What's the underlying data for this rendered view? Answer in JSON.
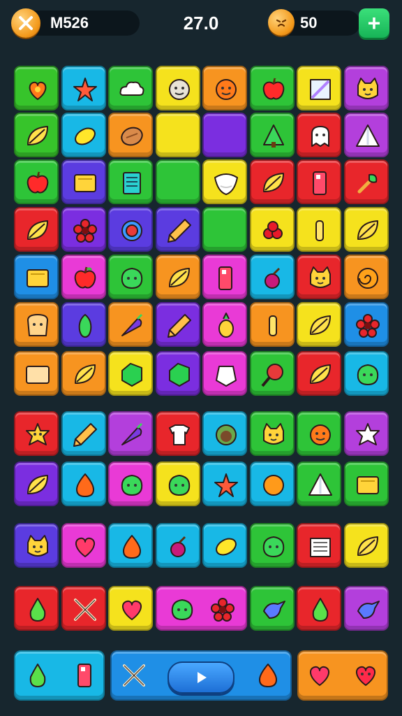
{
  "hud": {
    "left_value": "M526",
    "score": "27.0",
    "right_value": "50",
    "plus_label": "+",
    "coin_icon": "crossed-swords-icon",
    "right_coin_icon": "face-coin-icon"
  },
  "tile_rows": [
    {
      "colors": [
        "#37c42b",
        "#18b8e6",
        "#2ec438",
        "#f5e21d",
        "#f79420",
        "#2ec438",
        "#f5e21d",
        "#b33fdc"
      ],
      "icons": [
        "heart-fruit",
        "starfish",
        "cloud",
        "face-cookie",
        "orange-face",
        "apple",
        "ruler",
        "cat-face"
      ]
    },
    {
      "colors": [
        "#37c42b",
        "#18b8e6",
        "#f79420",
        "#f5e21d",
        "#7b2ee0",
        "#2ec438",
        "#e8262b",
        "#b33fdc"
      ],
      "icons": [
        "leaf",
        "lemon",
        "bread",
        "empty",
        "empty",
        "tree",
        "ghost",
        "triangle"
      ]
    },
    {
      "colors": [
        "#2ec438",
        "#5b3ce0",
        "#2ec438",
        "#2ec438",
        "#f5e21d",
        "#e8262b",
        "#e8262b",
        "#e8262b"
      ],
      "icons": [
        "apple",
        "box",
        "book",
        "empty",
        "shell",
        "leaf",
        "cup",
        "broom"
      ]
    },
    {
      "colors": [
        "#e8262b",
        "#7b2ee0",
        "#5b3ce0",
        "#5b3ce0",
        "#2ec438",
        "#f5e21d",
        "#f5e21d",
        "#f5e21d"
      ],
      "icons": [
        "leaf",
        "flower",
        "ring",
        "pencil",
        "empty",
        "berries",
        "bone",
        "leaf"
      ]
    },
    {
      "colors": [
        "#1f8fe6",
        "#e93ad6",
        "#2ec438",
        "#f79420",
        "#e93ad6",
        "#18b8e6",
        "#e8262b",
        "#f79420"
      ],
      "icons": [
        "box",
        "apple",
        "face-blob",
        "leaf",
        "cup",
        "cherry",
        "cat-face",
        "snail"
      ]
    },
    {
      "colors": [
        "#f79420",
        "#5b3ce0",
        "#f79420",
        "#7b2ee0",
        "#e93ad6",
        "#f79420",
        "#f5e21d",
        "#1f8fe6"
      ],
      "icons": [
        "toast",
        "pepper",
        "carrot",
        "pencil",
        "pineapple",
        "bone",
        "leaf",
        "flower"
      ]
    },
    {
      "colors": [
        "#f79420",
        "#f79420",
        "#f5e21d",
        "#7b2ee0",
        "#e93ad6",
        "#2ec438",
        "#e8262b",
        "#18b8e6"
      ],
      "icons": [
        "card",
        "leaf",
        "gem",
        "gem",
        "diamond",
        "racket",
        "leaf",
        "face-blob"
      ]
    },
    {
      "colors": [
        "#e8262b",
        "#18b8e6",
        "#b33fdc",
        "#e8262b",
        "#18b8e6",
        "#2ec438",
        "#2ec438",
        "#b33fdc"
      ],
      "icons": [
        "star-face",
        "pencil",
        "carrot",
        "shirt",
        "coconut",
        "cat-face",
        "orange-face",
        "star"
      ]
    },
    {
      "colors": [
        "#7b2ee0",
        "#18b8e6",
        "#e93ad6",
        "#f5e21d",
        "#18b8e6",
        "#18b8e6",
        "#2ec438",
        "#2ec438"
      ],
      "icons": [
        "leaf",
        "drop",
        "face-blob",
        "face-blob",
        "starfish",
        "orange",
        "triangle",
        "box"
      ]
    },
    {
      "colors": [
        "#5b3ce0",
        "#e93ad6",
        "#18b8e6",
        "#18b8e6",
        "#18b8e6",
        "#2ec438",
        "#e8262b",
        "#f5e21d"
      ],
      "icons": [
        "cat-face",
        "heart",
        "drop",
        "cherry",
        "lemon",
        "face-blob",
        "paper-stack",
        "leaf"
      ]
    },
    {
      "colors": [
        "#e8262b",
        "#e8262b",
        "#f5e21d",
        "#e93ad6",
        "#e93ad6",
        "#2ec438",
        "#e8262b",
        "#b33fdc"
      ],
      "icons": [
        "pear",
        "swords",
        "heart",
        "face-blob",
        "flower",
        "bird",
        "pear",
        "bird"
      ]
    }
  ],
  "bottom": {
    "left_panel_color": "#18b8e6",
    "center_panel_color": "#1f8fe6",
    "right_panel_color": "#f79420",
    "left_icons": [
      "pear",
      "cup"
    ],
    "center_icons": [
      "swords",
      "drop"
    ],
    "right_icons": [
      "heart",
      "heart-face"
    ],
    "play_icon": "play-icon"
  }
}
